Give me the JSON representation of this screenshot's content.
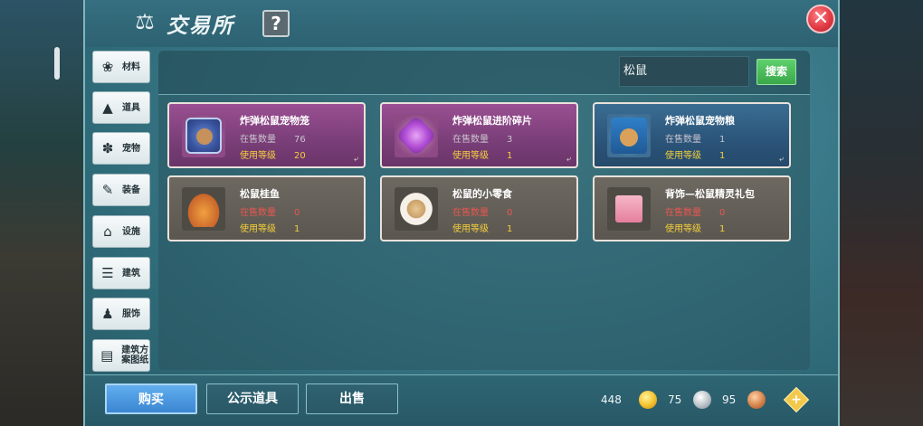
{
  "window": {
    "title": "交易所",
    "help_label": "?",
    "close_label": "✕"
  },
  "sidebar": {
    "items": [
      {
        "label": "材料",
        "icon": "materials-icon",
        "glyph": "❀"
      },
      {
        "label": "道具",
        "icon": "props-icon",
        "glyph": "▲"
      },
      {
        "label": "宠物",
        "icon": "pet-paw-icon",
        "glyph": "✽"
      },
      {
        "label": "装备",
        "icon": "equipment-icon",
        "glyph": "✎"
      },
      {
        "label": "设施",
        "icon": "facility-icon",
        "glyph": "⌂"
      },
      {
        "label": "建筑",
        "icon": "building-icon",
        "glyph": "☰"
      },
      {
        "label": "服饰",
        "icon": "clothing-icon",
        "glyph": "♟"
      },
      {
        "label": "建筑方案图纸",
        "icon": "blueprint-icon",
        "glyph": "▤"
      }
    ]
  },
  "search": {
    "value": "松鼠",
    "button_label": "搜索"
  },
  "labels": {
    "stock": "在售数量",
    "level": "使用等级"
  },
  "items": [
    {
      "name": "炸弹松鼠宠物笼",
      "stock": "76",
      "level": "20",
      "rarity": "purple",
      "icon": "squirrel-pet-cage-icon",
      "corner": "⤶"
    },
    {
      "name": "炸弹松鼠进阶碎片",
      "stock": "3",
      "level": "1",
      "rarity": "purple",
      "icon": "advance-shard-icon",
      "corner": "⤶"
    },
    {
      "name": "炸弹松鼠宠物粮",
      "stock": "1",
      "level": "1",
      "rarity": "blue",
      "icon": "pet-food-bag-icon",
      "corner": "⤶"
    },
    {
      "name": "松鼠桂鱼",
      "stock": "0",
      "level": "1",
      "rarity": "plain",
      "icon": "fried-fish-icon"
    },
    {
      "name": "松鼠的小零食",
      "stock": "0",
      "level": "1",
      "rarity": "plain",
      "icon": "snack-plate-icon"
    },
    {
      "name": "背饰—松鼠精灵礼包",
      "stock": "0",
      "level": "1",
      "rarity": "plain",
      "icon": "gift-box-icon"
    }
  ],
  "footer": {
    "tabs": [
      "购买",
      "公示道具",
      "出售"
    ],
    "active_tab": 0
  },
  "currency": {
    "gold": "448",
    "silver": "75",
    "copper": "95",
    "add_label": "+"
  },
  "colors": {
    "stock_zero": "#e8564f",
    "level": "#f4cf3a",
    "active_tab": "#3b86d2"
  }
}
